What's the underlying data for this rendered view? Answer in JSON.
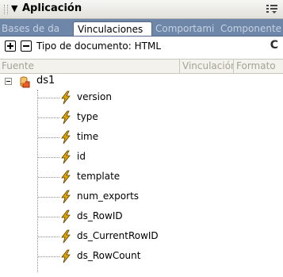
{
  "panel": {
    "title": "Aplicación",
    "collapse_glyph": "▼"
  },
  "tabs": [
    {
      "label": "Bases de da",
      "active": false
    },
    {
      "label": "Vinculaciones",
      "active": true
    },
    {
      "label": "Comportami",
      "active": false
    },
    {
      "label": "Componente",
      "active": false
    }
  ],
  "toolbar": {
    "add_label": "+",
    "remove_label": "−",
    "doctype_label": "Tipo de documento: HTML",
    "refresh_glyph": "C"
  },
  "columns": [
    "Fuente",
    "Vinculación",
    "Formato"
  ],
  "tree": {
    "root": "ds1",
    "items": [
      "version",
      "type",
      "time",
      "id",
      "template",
      "num_exports",
      "ds_RowID",
      "ds_CurrentRowID",
      "ds_RowCount"
    ]
  },
  "colors": {
    "tab_strip": "#6e86a8",
    "bolt": "#e0a800",
    "header_text": "#a4a39a"
  }
}
